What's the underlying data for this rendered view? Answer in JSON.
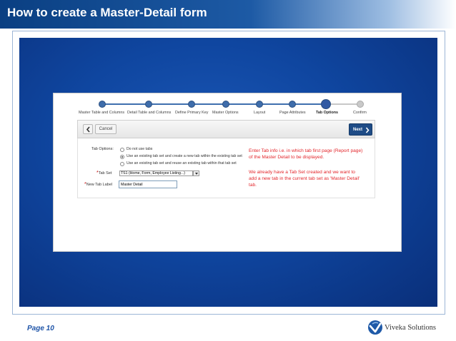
{
  "slide": {
    "title": "How to create a Master-Detail form",
    "page_label": "Page 10",
    "brand": "Viveka Solutions"
  },
  "wizard": {
    "steps": [
      {
        "label": "Master Table and Columns",
        "state": "done"
      },
      {
        "label": "Detail Table and Columns",
        "state": "done"
      },
      {
        "label": "Define Primary Key",
        "state": "done"
      },
      {
        "label": "Master Options",
        "state": "done"
      },
      {
        "label": "Layout",
        "state": "done"
      },
      {
        "label": "Page Attributes",
        "state": "done"
      },
      {
        "label": "Tab Options",
        "state": "current"
      },
      {
        "label": "Confirm",
        "state": "todo"
      }
    ],
    "cancel_label": "Cancel",
    "next_label": "Next"
  },
  "form": {
    "tab_options_label": "Tab Options:",
    "options": [
      {
        "label": "Do not use tabs",
        "selected": false
      },
      {
        "label": "Use an existing tab set and create a new tab within the existing tab set",
        "selected": true
      },
      {
        "label": "Use an existing tab set and reuse an existing tab within that tab set",
        "selected": false
      }
    ],
    "tab_set_label": "Tab Set",
    "tab_set_value": "TS1 (Home, Form, Employee Listing...)",
    "new_tab_label": "New Tab Label",
    "new_tab_value": "Master Detail"
  },
  "annotations": {
    "note1": "Enter Tab info i.e. in which tab first page (Report page) of the Master Detail to be displayed.",
    "note2": "We already have a Tab Set created and we want to add a new tab in the current tab set as 'Master Detail' tab."
  },
  "colors": {
    "accent": "#1f4c86",
    "annotation": "#e3262b",
    "page_label": "#1f55a8"
  }
}
